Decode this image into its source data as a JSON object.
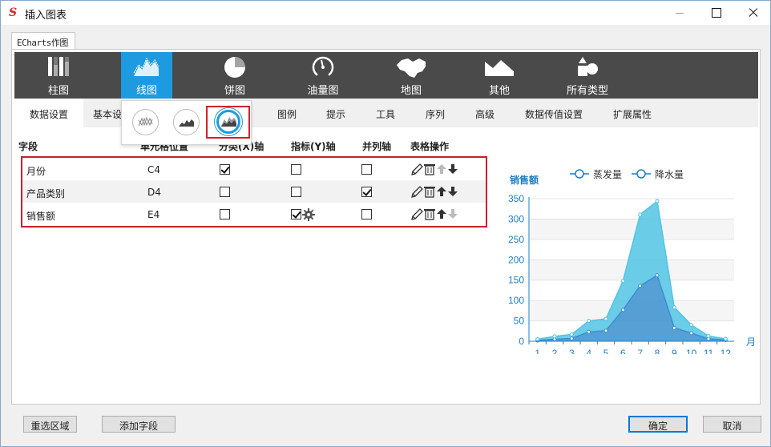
{
  "window": {
    "title": "插入图表",
    "app_icon": "S"
  },
  "outer_tab": "ECharts作图",
  "chart_types": [
    {
      "label": "柱图",
      "icon": "bar-chart-icon"
    },
    {
      "label": "线图",
      "icon": "line-chart-icon",
      "active": true
    },
    {
      "label": "饼图",
      "icon": "pie-chart-icon"
    },
    {
      "label": "油量图",
      "icon": "gauge-icon"
    },
    {
      "label": "地图",
      "icon": "map-icon"
    },
    {
      "label": "其他",
      "icon": "other-chart-icon"
    },
    {
      "label": "所有类型",
      "icon": "all-types-icon"
    }
  ],
  "sub_tabs": [
    "数据设置",
    "基本设",
    "图例",
    "提示",
    "工具",
    "序列",
    "高级",
    "数据传值设置",
    "扩展属性"
  ],
  "line_subtypes": [
    {
      "icon": "line-basic-icon"
    },
    {
      "icon": "area-icon"
    },
    {
      "icon": "stacked-area-icon",
      "selected": true
    }
  ],
  "table": {
    "headers": [
      "字段",
      "单元格位置",
      "分类(X)轴",
      "指标(Y)轴",
      "并列轴",
      "表格操作"
    ],
    "rows": [
      {
        "field": "月份",
        "cell": "C4",
        "x_axis": true,
        "y_axis": false,
        "parallel": false,
        "y_gear": false,
        "down_enabled": true
      },
      {
        "field": "产品类别",
        "cell": "D4",
        "x_axis": false,
        "y_axis": false,
        "parallel": true,
        "y_gear": false,
        "down_enabled": true
      },
      {
        "field": "销售额",
        "cell": "E4",
        "x_axis": false,
        "y_axis": true,
        "parallel": false,
        "y_gear": true,
        "down_enabled": false
      }
    ]
  },
  "chart_data": {
    "type": "area",
    "title": "",
    "ylabel": "销售额",
    "xlabel": "月",
    "categories": [
      "1",
      "2",
      "3",
      "4",
      "5",
      "6",
      "7",
      "8",
      "9",
      "10",
      "11",
      "12"
    ],
    "ylim": [
      0,
      350
    ],
    "yticks": [
      0,
      50,
      100,
      150,
      200,
      250,
      300,
      350
    ],
    "stacked": true,
    "legend_position": "top",
    "series": [
      {
        "name": "蒸发量",
        "values": [
          2,
          5,
          7,
          23,
          26,
          77,
          136,
          162,
          33,
          20,
          6,
          3
        ],
        "color": "#3a8fcf"
      },
      {
        "name": "降水量",
        "values": [
          3,
          7,
          10,
          27,
          29,
          71,
          175,
          182,
          50,
          20,
          7,
          3
        ],
        "color": "#52c4e4"
      }
    ],
    "grid": true
  },
  "buttons": {
    "reselect": "重选区域",
    "add_field": "添加字段",
    "ok": "确定",
    "cancel": "取消"
  },
  "colors": {
    "accent": "#1e9ae0",
    "toolbar": "#4a4a4a",
    "highlight_border": "#c8202b"
  }
}
